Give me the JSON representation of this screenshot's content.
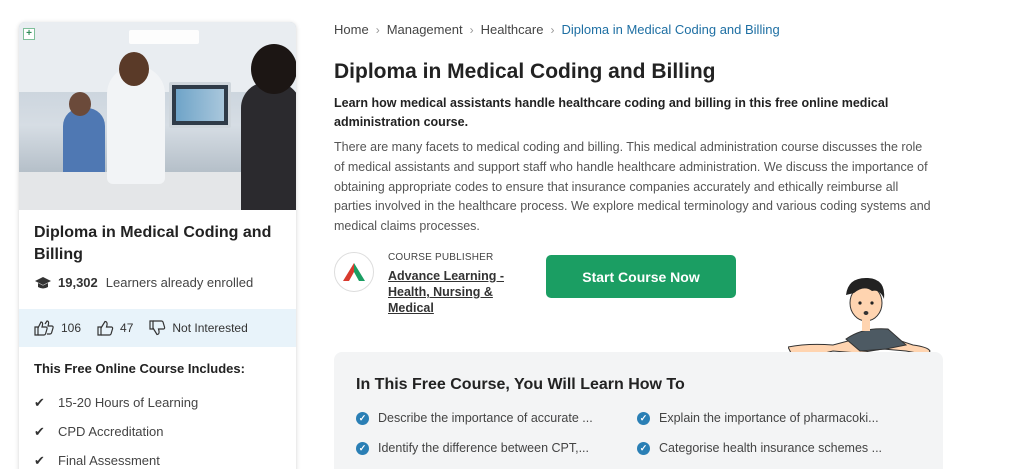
{
  "colors": {
    "accent": "#1b9e63",
    "link": "#1e6fa3",
    "check": "#2a7fb5",
    "reaction_bg": "#e8f3fa"
  },
  "breadcrumb": [
    {
      "label": "Home"
    },
    {
      "label": "Management"
    },
    {
      "label": "Healthcare"
    },
    {
      "label": "Diploma in Medical Coding and Billing",
      "current": true
    }
  ],
  "card": {
    "title": "Diploma in Medical Coding and Billing",
    "enrolled_count": "19,302",
    "enrolled_label": "Learners already enrolled",
    "reactions": {
      "likes": "106",
      "likes_icon": "double-thumbs-up-icon",
      "single_likes": "47",
      "single_likes_icon": "thumbs-up-icon",
      "not_interested": "Not Interested",
      "not_interested_icon": "thumbs-down-icon"
    },
    "includes_title": "This Free Online Course Includes:",
    "includes": [
      "15-20 Hours of Learning",
      "CPD Accreditation",
      "Final Assessment"
    ]
  },
  "main": {
    "title": "Diploma in Medical Coding and Billing",
    "lead": "Learn how medical assistants handle healthcare coding and billing in this free online medical administration course.",
    "description": "There are many facets to medical coding and billing. This medical administration course discusses the role of medical assistants and support staff who handle healthcare administration. We discuss the importance of obtaining appropriate codes to ensure that insurance companies accurately and ethically reimburse all parties involved in the healthcare process. We explore medical terminology and various coding systems and medical claims processes.",
    "publisher_label": "COURSE PUBLISHER",
    "publisher_name": "Advance Learning - Health, Nursing & Medical",
    "start_button": "Start Course Now"
  },
  "learn": {
    "title": "In This Free Course, You Will Learn How To",
    "items": [
      "Describe the importance of accurate ...",
      "Explain the importance of pharmacoki...",
      "Identify the difference between CPT,...",
      "Categorise health insurance schemes ..."
    ]
  }
}
